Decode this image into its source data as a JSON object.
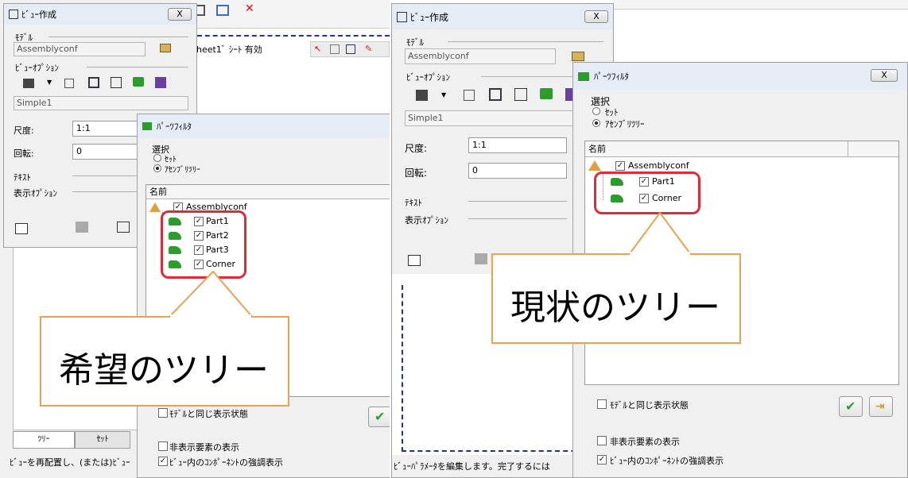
{
  "colors": {
    "highlight_red": "#e02a3a",
    "callout_orange": "#f0a050",
    "check_green": "#2e9e2e"
  },
  "left_view_dialog": {
    "title": "ﾋﾞｭｰ作成",
    "close_label": "X",
    "model_label": "ﾓﾃﾞﾙ",
    "model_value": "Assemblyconf",
    "view_options_label": "ﾋﾞｭｰｵﾌﾟｼｮﾝ",
    "config_value": "Simple1",
    "scale_label": "尺度:",
    "scale_value": "1:1",
    "rotation_label": "回転:",
    "rotation_value": "0",
    "text_label": "ﾃｷｽﾄ",
    "display_options_label": "表示ｵﾌﾟｼｮﾝ"
  },
  "left_background": {
    "sheet_text": "heet1ﾞ ｼｰﾄ 有効",
    "tab_tree": "ﾂﾘｰ",
    "tab_set": "ｾｯﾄ",
    "status_text": "ﾋﾞｭｰを再配置し、(または)ﾋﾞｭｰ"
  },
  "left_parts_filter": {
    "title": "ﾊﾟｰﾂﾌｨﾙﾀ",
    "selection_label": "選択",
    "radio_set": "ｾｯﾄ",
    "radio_assembly": "ｱｾﾝﾌﾞﾘﾂﾘｰ",
    "column_name": "名前",
    "root": "Assemblyconf",
    "parts": [
      "Part1",
      "Part2",
      "Part3",
      "Corner"
    ],
    "same_state_label": "ﾓﾃﾞﾙと同じ表示状態",
    "hidden_label": "非表示要素の表示",
    "emphasis_label": "ﾋﾞｭｰ内のｺﾝﾎﾟｰﾈﾝﾄの強調表示"
  },
  "right_view_dialog": {
    "title": "ﾋﾞｭｰ作成",
    "close_label": "X",
    "model_label": "ﾓﾃﾞﾙ",
    "model_value": "Assemblyconf",
    "view_options_label": "ﾋﾞｭｰｵﾌﾟｼｮﾝ",
    "config_value": "Simple1",
    "scale_label": "尺度:",
    "scale_value": "1:1",
    "rotation_label": "回転:",
    "rotation_value": "0",
    "text_label": "ﾃｷｽﾄ",
    "display_options_label": "表示ｵﾌﾟｼｮﾝ",
    "status_text": "ﾋﾞｭｰﾊﾟﾗﾒｰﾀを編集します。完了するには"
  },
  "right_parts_filter": {
    "title": "ﾊﾟｰﾂﾌｨﾙﾀ",
    "close_label": "X",
    "selection_label": "選択",
    "radio_set": "ｾｯﾄ",
    "radio_assembly": "ｱｾﾝﾌﾞﾘﾂﾘｰ",
    "column_name": "名前",
    "root": "Assemblyconf",
    "parts": [
      "Part1",
      "Corner"
    ],
    "same_state_label": "ﾓﾃﾞﾙと同じ表示状態",
    "hidden_label": "非表示要素の表示",
    "emphasis_label": "ﾋﾞｭｰ内のｺﾝﾎﾟｰﾈﾝﾄの強調表示"
  },
  "callouts": {
    "desired": "希望のツリー",
    "current": "現状のツリー"
  }
}
